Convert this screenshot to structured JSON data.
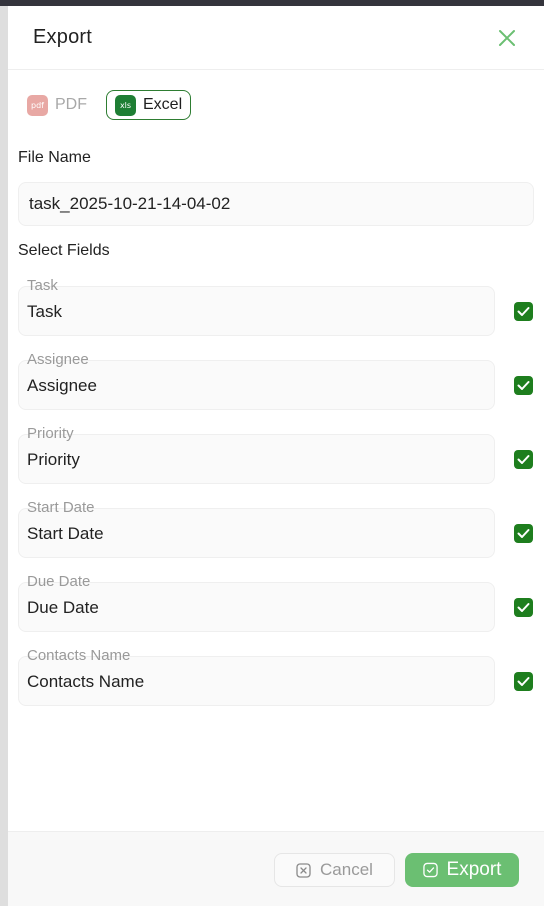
{
  "dialog": {
    "title": "Export"
  },
  "formats": {
    "pdf": {
      "label": "PDF",
      "icon_text": "pdf",
      "icon": "pdf-file-icon"
    },
    "excel": {
      "label": "Excel",
      "icon_text": "xls",
      "icon": "excel-file-icon",
      "selected": true
    }
  },
  "file_name": {
    "label": "File Name",
    "value": "task_2025-10-21-14-04-02"
  },
  "select_fields": {
    "label": "Select Fields",
    "items": [
      {
        "caption": "Task",
        "value": "Task",
        "checked": true
      },
      {
        "caption": "Assignee",
        "value": "Assignee",
        "checked": true
      },
      {
        "caption": "Priority",
        "value": "Priority",
        "checked": true
      },
      {
        "caption": "Start Date",
        "value": "Start Date",
        "checked": true
      },
      {
        "caption": "Due Date",
        "value": "Due Date",
        "checked": true
      },
      {
        "caption": "Contacts Name",
        "value": "Contacts Name",
        "checked": true
      }
    ]
  },
  "footer": {
    "cancel_label": "Cancel",
    "export_label": "Export"
  },
  "colors": {
    "accent": "#6bbf72",
    "checkbox": "#1e7e1e",
    "excel": "#1e7e34",
    "pdf": "#e8a8a4"
  }
}
